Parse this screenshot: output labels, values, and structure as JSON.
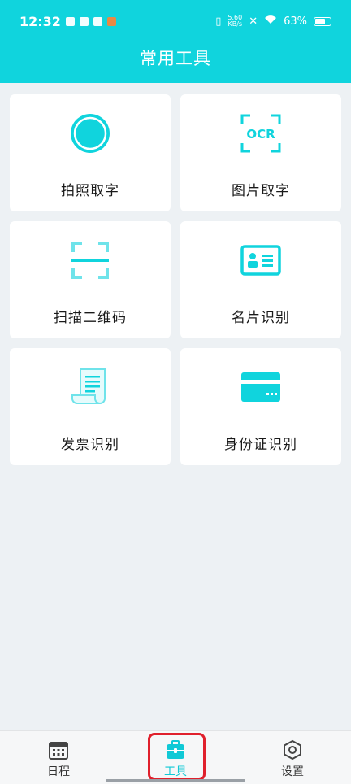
{
  "status_bar": {
    "time": "12:32",
    "speed_value": "5.60",
    "speed_unit": "KB/s",
    "battery": "63%"
  },
  "header": {
    "title": "常用工具"
  },
  "tools": [
    {
      "label": "拍照取字",
      "icon": "camera-circle-icon"
    },
    {
      "label": "图片取字",
      "icon": "ocr-icon"
    },
    {
      "label": "扫描二维码",
      "icon": "scan-icon"
    },
    {
      "label": "名片识别",
      "icon": "business-card-icon"
    },
    {
      "label": "发票识别",
      "icon": "invoice-icon"
    },
    {
      "label": "身份证识别",
      "icon": "id-card-icon"
    }
  ],
  "bottom_nav": {
    "items": [
      {
        "label": "日程",
        "icon": "calendar-icon"
      },
      {
        "label": "工具",
        "icon": "toolbox-icon",
        "active": true
      },
      {
        "label": "设置",
        "icon": "settings-hexagon-icon"
      }
    ]
  },
  "colors": {
    "accent": "#10D4DD",
    "highlight": "#E0202C",
    "background": "#EDF1F4"
  }
}
